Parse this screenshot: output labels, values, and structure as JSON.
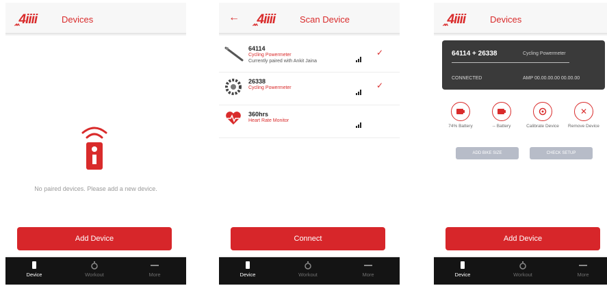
{
  "brand": {
    "logo_prefix": "‸‸",
    "logo_text": "4iiii",
    "accent": "#d92b2b",
    "dark": "#141414"
  },
  "tabs": [
    {
      "label": "Device",
      "icon": "phone-device-icon"
    },
    {
      "label": "Workout",
      "icon": "stopwatch-icon"
    },
    {
      "label": "More",
      "icon": "more-dots-icon"
    }
  ],
  "screen1": {
    "title": "Devices",
    "empty_message": "No paired devices. Please add a new device.",
    "button_label": "Add Device"
  },
  "screen2": {
    "back_icon": "back-arrow-icon",
    "title": "Scan Device",
    "devices": [
      {
        "name": "64114",
        "type": "Cycling Powermeter",
        "status": "Currently paired with Ankit Jaina",
        "icon": "crank-arm-icon",
        "checked": true
      },
      {
        "name": "26338",
        "type": "Cycling Powermeter",
        "status": "",
        "icon": "gear-icon",
        "checked": true
      },
      {
        "name": "360hrs",
        "type": "Heart Rate Monitor",
        "status": "",
        "icon": "heart-monitor-icon",
        "checked": false
      }
    ],
    "button_label": "Connect"
  },
  "screen3": {
    "title": "Devices",
    "card": {
      "title": "64114 + 26338",
      "type": "Cycling Powermeter",
      "status": "CONNECTED",
      "version": "AMP 00.00.00.00 00.00.00"
    },
    "actions": [
      {
        "label": "74% Battery",
        "icon": "battery-icon"
      },
      {
        "label": "-- Battery",
        "icon": "battery-icon"
      },
      {
        "label": "Calibrate Device",
        "icon": "calibrate-icon"
      },
      {
        "label": "Remove Device",
        "icon": "remove-icon"
      }
    ],
    "small_buttons": [
      "ADD BIKE SIZE",
      "CHECK SETUP"
    ],
    "button_label": "Add Device"
  }
}
